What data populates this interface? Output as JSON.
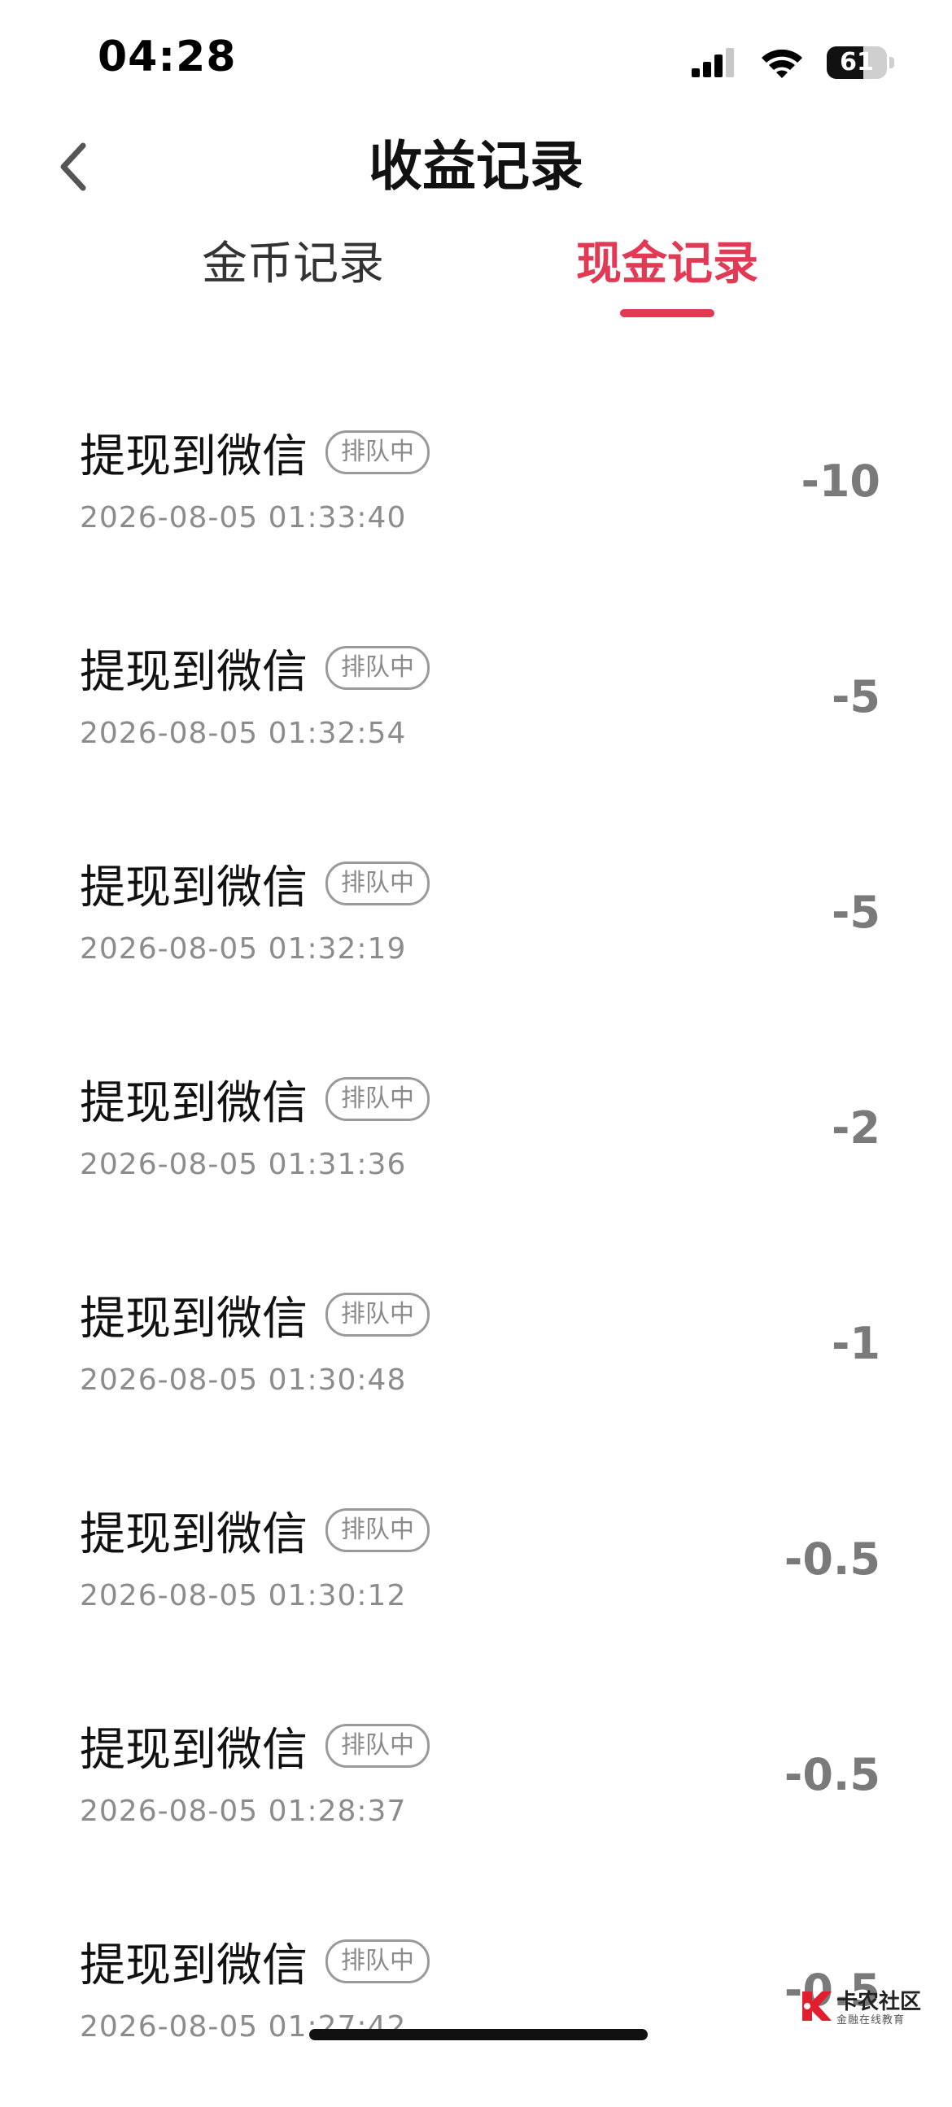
{
  "status_bar": {
    "time": "04:28",
    "battery_text": "61",
    "battery_level": 0.61
  },
  "nav": {
    "title": "收益记录"
  },
  "tabs": [
    {
      "label": "金币记录",
      "active": false
    },
    {
      "label": "现金记录",
      "active": true
    }
  ],
  "colors": {
    "accent": "#e23a55",
    "amount": "#7a7a7a",
    "secondary_text": "#8c8c8c"
  },
  "records": [
    {
      "title": "提现到微信",
      "status": "排队中",
      "time": "2026-08-05 01:33:40",
      "amount": "-10"
    },
    {
      "title": "提现到微信",
      "status": "排队中",
      "time": "2026-08-05 01:32:54",
      "amount": "-5"
    },
    {
      "title": "提现到微信",
      "status": "排队中",
      "time": "2026-08-05 01:32:19",
      "amount": "-5"
    },
    {
      "title": "提现到微信",
      "status": "排队中",
      "time": "2026-08-05 01:31:36",
      "amount": "-2"
    },
    {
      "title": "提现到微信",
      "status": "排队中",
      "time": "2026-08-05 01:30:48",
      "amount": "-1"
    },
    {
      "title": "提现到微信",
      "status": "排队中",
      "time": "2026-08-05 01:30:12",
      "amount": "-0.5"
    },
    {
      "title": "提现到微信",
      "status": "排队中",
      "time": "2026-08-05 01:28:37",
      "amount": "-0.5"
    },
    {
      "title": "提现到微信",
      "status": "排队中",
      "time": "2026-08-05 01:27:42",
      "amount": "-0.5"
    }
  ],
  "watermark": {
    "name": "卡农社区",
    "tagline": "金融在线教育"
  }
}
